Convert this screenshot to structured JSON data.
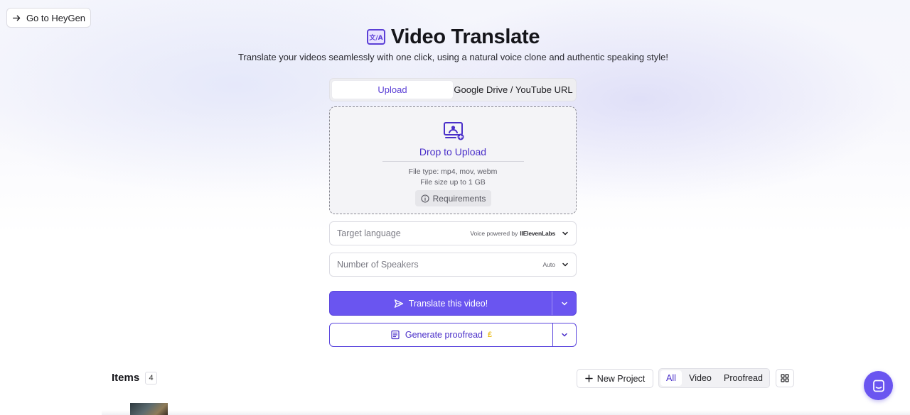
{
  "header": {
    "back_label": "Go to HeyGen",
    "title": "Video Translate",
    "subtitle": "Translate your videos seamlessly with one click, using a natural voice clone and authentic speaking style!"
  },
  "tabs": [
    {
      "label": "Upload",
      "active": true
    },
    {
      "label": "Google Drive / YouTube URL",
      "active": false
    }
  ],
  "upload": {
    "drop_label": "Drop to Upload",
    "file_type": "File type: mp4, mov, webm",
    "file_size": "File size up to 1 GB",
    "requirements_label": "Requirements"
  },
  "target_language": {
    "placeholder": "Target language",
    "hint": "Voice powered by",
    "brand": "IIElevenLabs"
  },
  "speakers": {
    "placeholder": "Number of Speakers",
    "hint": "Auto"
  },
  "actions": {
    "translate_label": "Translate this video!",
    "proofread_label": "Generate proofread"
  },
  "items": {
    "title": "Items",
    "count": "4",
    "new_project_label": "New Project",
    "filters": [
      "All",
      "Video",
      "Proofread"
    ],
    "active_filter": "All"
  },
  "colors": {
    "accent": "#6a55f0",
    "accent_text": "#4a2fc9",
    "coin": "#e7b400"
  }
}
